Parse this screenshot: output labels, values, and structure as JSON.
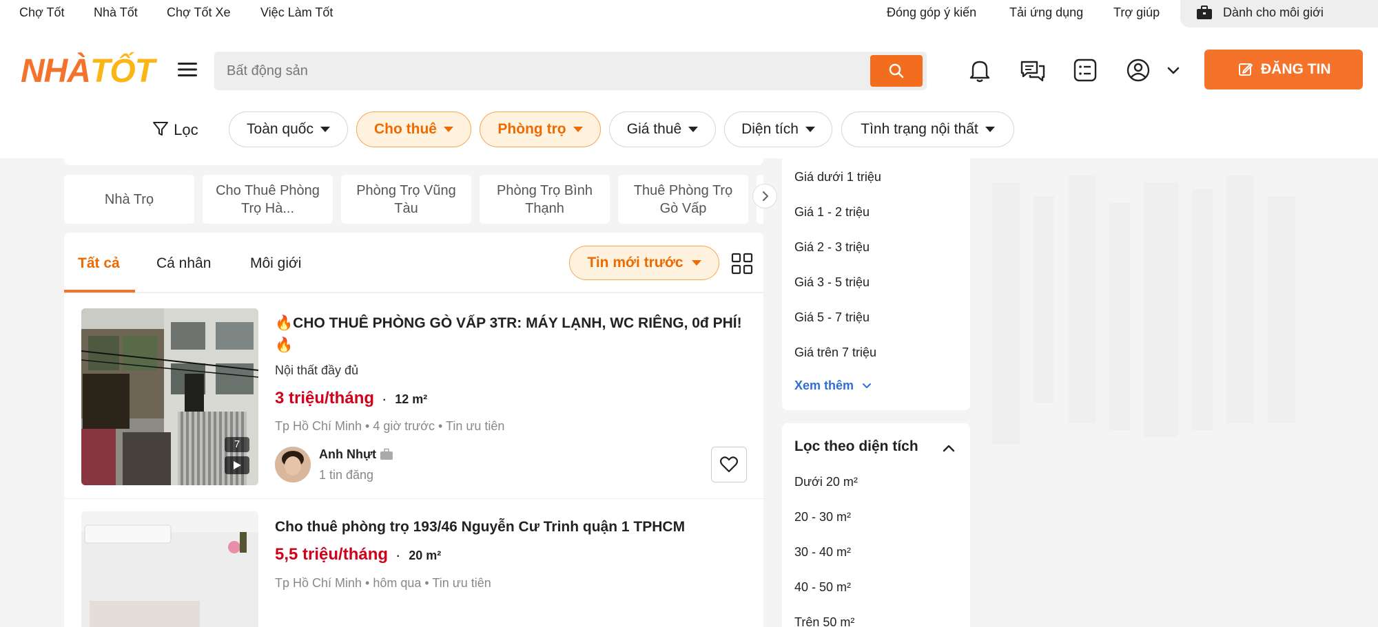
{
  "topbar": {
    "links": [
      "Chợ Tốt",
      "Nhà Tốt",
      "Chợ Tốt Xe",
      "Việc Làm Tốt"
    ],
    "right_links": [
      "Đóng góp ý kiến",
      "Tải ứng dụng",
      "Trợ giúp"
    ],
    "broker_label": "Dành cho môi giới"
  },
  "header": {
    "logo_part1": "NHÀ",
    "logo_part2": "TỐT",
    "search_placeholder": "Bất động sản",
    "post_label": "ĐĂNG TIN"
  },
  "filters": {
    "filter_label": "Lọc",
    "chips": [
      "Toàn quốc",
      "Cho thuê",
      "Phòng trọ",
      "Giá thuê",
      "Diện tích",
      "Tình trạng nội thất"
    ],
    "active_chips": [
      "Cho thuê",
      "Phòng trọ"
    ]
  },
  "quick_tags": [
    "Nhà Trọ",
    "Cho Thuê Phòng Trọ Hà...",
    "Phòng Trọ Vũng Tàu",
    "Phòng Trọ Bình Thạnh",
    "Thuê Phòng Trọ Gò Vấp"
  ],
  "tabs": {
    "items": [
      "Tất cả",
      "Cá nhân",
      "Môi giới"
    ],
    "active": "Tất cả",
    "sort_label": "Tin mới trước"
  },
  "listings": [
    {
      "title": "🔥CHO THUÊ PHÒNG GÒ VẤP 3TR: MÁY LẠNH, WC RIÊNG, 0đ PHÍ!🔥",
      "subtitle": "Nội thất đầy đủ",
      "price": "3 triệu/tháng",
      "area": "12 m²",
      "meta": "Tp Hồ Chí Minh • 4 giờ trước • Tin ưu tiên",
      "photo_count": "7",
      "seller_name": "Anh Nhựt",
      "seller_posts": "1 tin đăng"
    },
    {
      "title": "Cho thuê phòng trọ 193/46 Nguyễn Cư Trinh quận 1 TPHCM",
      "price": "5,5 triệu/tháng",
      "area": "20 m²",
      "meta": "Tp Hồ Chí Minh • hôm qua • Tin ưu tiên"
    }
  ],
  "sidebar": {
    "price_options": [
      "Giá dưới 1 triệu",
      "Giá 1 - 2 triệu",
      "Giá 2 - 3 triệu",
      "Giá 3 - 5 triệu",
      "Giá 5 - 7 triệu",
      "Giá trên 7 triệu"
    ],
    "see_more": "Xem thêm",
    "area_title": "Lọc theo diện tích",
    "area_options": [
      "Dưới 20 m²",
      "20 - 30 m²",
      "30 - 40 m²",
      "40 - 50 m²",
      "Trên 50 m²"
    ]
  },
  "colors": {
    "accent": "#f5722a",
    "active_chip_bg": "#fff2df",
    "price_red": "#d0021b",
    "link_blue": "#2f6fd3"
  },
  "icons": [
    "filter-icon",
    "menu-icon",
    "search-icon",
    "bell-icon",
    "chat-icon",
    "list-icon",
    "user-icon",
    "chevron-down-icon",
    "edit-icon",
    "briefcase-icon",
    "grid-view-icon",
    "heart-icon",
    "play-icon",
    "chevron-right-icon",
    "chevron-up-icon"
  ]
}
